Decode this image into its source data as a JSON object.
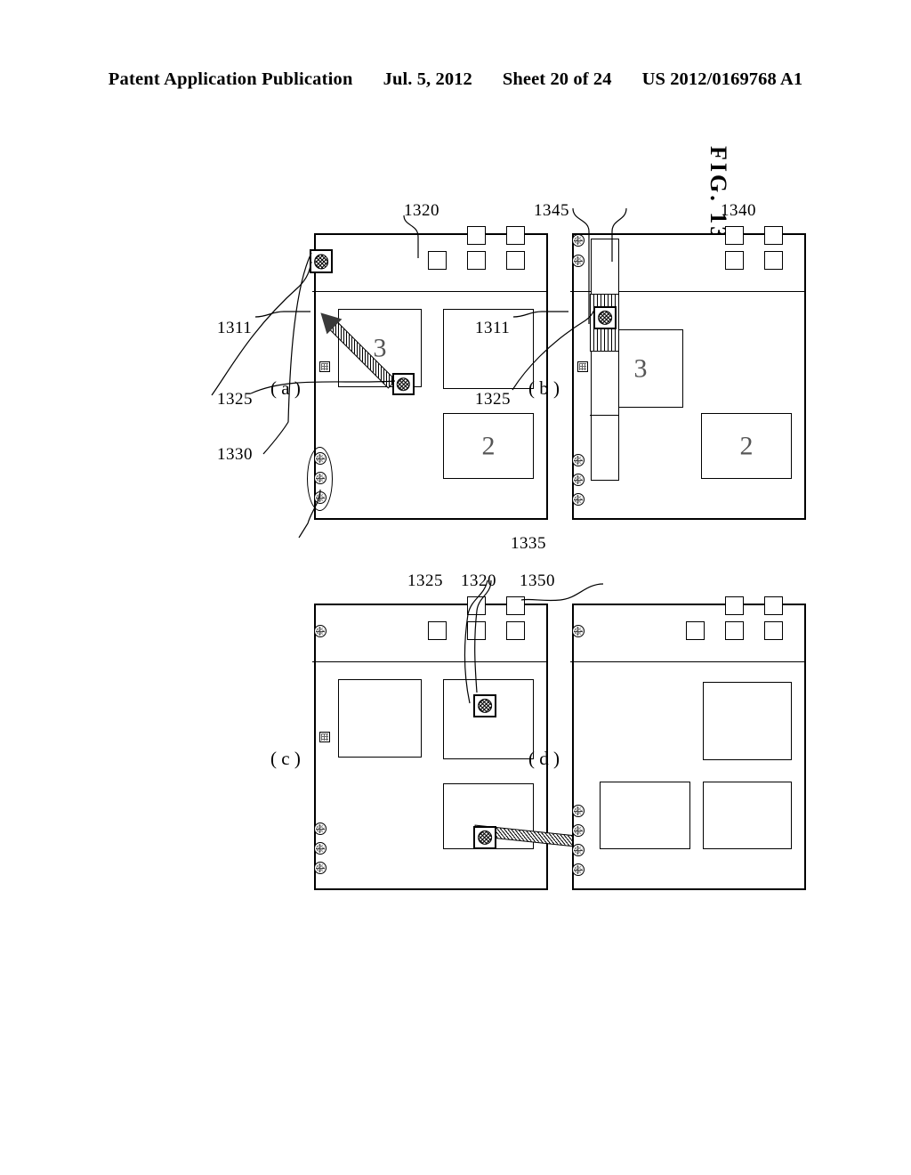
{
  "header": {
    "publication": "Patent Application Publication",
    "date": "Jul. 5, 2012",
    "sheet": "Sheet 20 of 24",
    "patent_number": "US 2012/0169768 A1"
  },
  "figure": {
    "title": "FIG. 13",
    "panels": [
      {
        "id": "a",
        "label": "( a )"
      },
      {
        "id": "b",
        "label": "( b )"
      },
      {
        "id": "c",
        "label": "( c )"
      },
      {
        "id": "d",
        "label": "( d )"
      }
    ]
  },
  "reference_numerals": {
    "device_body_a": "1311",
    "device_body_b": "1311",
    "window_source": "1320",
    "cursor": "1325",
    "drop_target": "1330",
    "button_group": "1335",
    "strip": "1340",
    "highlighted_segment": "1345",
    "new_window": "1350",
    "window_c_1320": "1320",
    "window_c_1325": "1325"
  },
  "panel_a": {
    "windows": [
      {
        "name": "window-2",
        "label": "2"
      },
      {
        "name": "window-blank",
        "label": ""
      },
      {
        "name": "window-3",
        "label": "3"
      }
    ],
    "dock_icon_count": 5,
    "circle_button_count": 3,
    "mini_icon": "grid-icon",
    "drag": {
      "from": "window-area",
      "to": "dock-circle-button"
    }
  },
  "panel_b": {
    "windows": [
      {
        "name": "window-2",
        "label": "2"
      },
      {
        "name": "window-3",
        "label": "3"
      }
    ],
    "dock_icon_count": 4,
    "circle_button_count_top": 3,
    "circle_button_count_bottom": 2,
    "strip_segments": 4,
    "highlighted_segment_index": 3,
    "mini_icon": "grid-icon"
  },
  "panel_c": {
    "windows": [
      {
        "name": "window-top-left",
        "label": ""
      },
      {
        "name": "window-top-right",
        "label": ""
      },
      {
        "name": "window-bottom-left",
        "label": ""
      }
    ],
    "dock_icon_count": 5,
    "circle_button_count": 3,
    "mini_icon": "grid-icon",
    "drag": {
      "from": "dock-area",
      "to": "window-top-right"
    }
  },
  "panel_d": {
    "windows": [
      {
        "name": "window-top-left",
        "label": ""
      },
      {
        "name": "window-top-right",
        "label": ""
      },
      {
        "name": "window-bottom-left",
        "label": ""
      }
    ],
    "dock_icon_count": 5,
    "circle_button_count": 4,
    "home_button": "home-circle"
  },
  "colors": {
    "ink": "#000000",
    "paper": "#ffffff",
    "digit": "#555555"
  }
}
